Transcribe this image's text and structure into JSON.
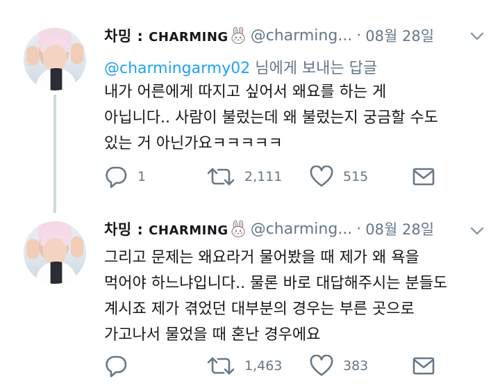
{
  "tweets": [
    {
      "name": "차밍 :",
      "brand": "CHARMING",
      "handle": "@charming...",
      "separator": "·",
      "date": "08월 28일",
      "reply_mention": "@charmingarmy02",
      "reply_text": "님에게 보내는 답글",
      "lines": [
        "내가 어른에게 따지고 싶어서 왜요를 하는 게",
        "아닙니다.. 사람이 불렀는데 왜 불렀는지 궁금할 수도",
        "있는 거 아닌가요ㅋㅋㅋㅋㅋ"
      ],
      "replies": "1",
      "retweets": "2,111",
      "likes": "515"
    },
    {
      "name": "차밍 :",
      "brand": "CHARMING",
      "handle": "@charming...",
      "separator": "·",
      "date": "08월 28일",
      "lines": [
        "그리고 문제는 왜요라거 물어봤을 때 제가 왜 욕을",
        "먹어야 하느냐입니다.. 물론 바로 대답해주시는 분들도",
        "계시죠 제가 겪었던 대부분의 경우는 부른 곳으로",
        "가고나서 물었을 때 혼난 경우에요"
      ],
      "replies": "",
      "retweets": "1,463",
      "likes": "383"
    }
  ],
  "icons": {
    "reply": "reply-icon",
    "retweet": "retweet-icon",
    "like": "heart-icon",
    "message": "envelope-icon",
    "menu": "chevron-down-icon",
    "badge": "bunny-emoji-icon"
  },
  "colors": {
    "text": "#14171a",
    "secondary": "#657786",
    "link": "#1da1f2",
    "thread_line": "#cfd9de"
  }
}
